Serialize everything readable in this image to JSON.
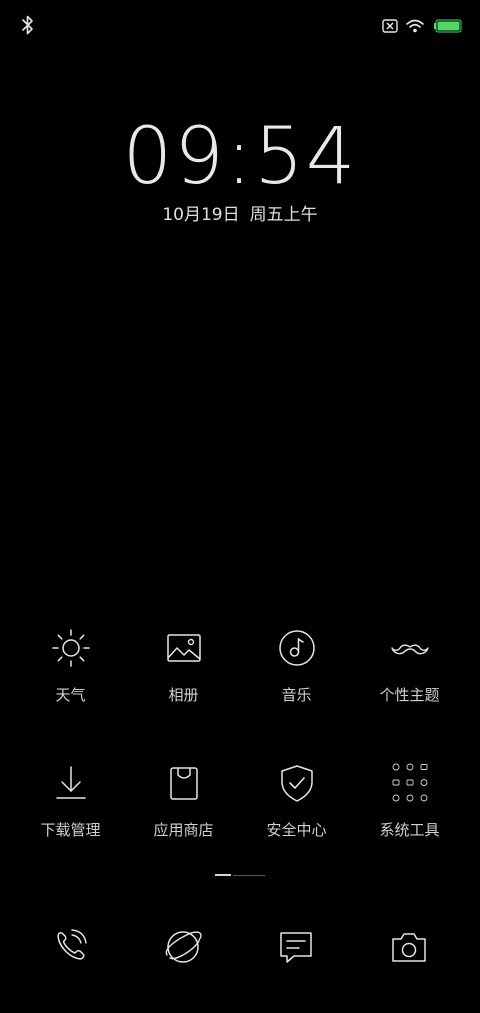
{
  "status_bar": {
    "icons": [
      "bluetooth-icon",
      "no-sim-icon",
      "wifi-icon",
      "battery-icon"
    ],
    "battery_level": 1.0,
    "battery_color": "#4cd964"
  },
  "lockscreen": {
    "time": "09:54",
    "date": "10月19日",
    "weekday_period": "周五上午"
  },
  "apps": [
    [
      {
        "label": "天气",
        "icon": "sun-icon"
      },
      {
        "label": "相册",
        "icon": "gallery-icon"
      },
      {
        "label": "音乐",
        "icon": "music-icon"
      },
      {
        "label": "个性主题",
        "icon": "mustache-icon"
      }
    ],
    [
      {
        "label": "下载管理",
        "icon": "download-icon"
      },
      {
        "label": "应用商店",
        "icon": "store-bag-icon"
      },
      {
        "label": "安全中心",
        "icon": "shield-check-icon"
      },
      {
        "label": "系统工具",
        "icon": "tools-folder-icon"
      }
    ]
  ],
  "pager": {
    "pages": 2,
    "current": 1
  },
  "dock": [
    {
      "icon": "phone-icon"
    },
    {
      "icon": "browser-planet-icon"
    },
    {
      "icon": "message-icon"
    },
    {
      "icon": "camera-icon"
    }
  ],
  "colors": {
    "background": "#000000",
    "foreground": "#e6e6e6"
  }
}
